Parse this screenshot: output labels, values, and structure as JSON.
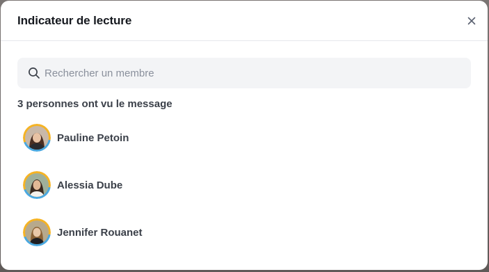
{
  "modal": {
    "title": "Indicateur de lecture",
    "close_icon": "close-icon"
  },
  "search": {
    "placeholder": "Rechercher un membre",
    "value": "",
    "icon": "search-icon"
  },
  "summary": {
    "count_label": "3 personnes ont vu le message"
  },
  "members": [
    {
      "name": "Pauline Petoin",
      "avatar_bg": "#8a6a5a"
    },
    {
      "name": "Alessia Dube",
      "avatar_bg": "#6b8a72"
    },
    {
      "name": "Jennifer Rouanet",
      "avatar_bg": "#9a8a6a"
    }
  ],
  "colors": {
    "accent_ring_blue": "#4aa8e0",
    "accent_ring_yellow": "#f5b324",
    "text_primary": "#16191f",
    "text_secondary": "#3b4049",
    "search_bg": "#f3f4f6"
  }
}
